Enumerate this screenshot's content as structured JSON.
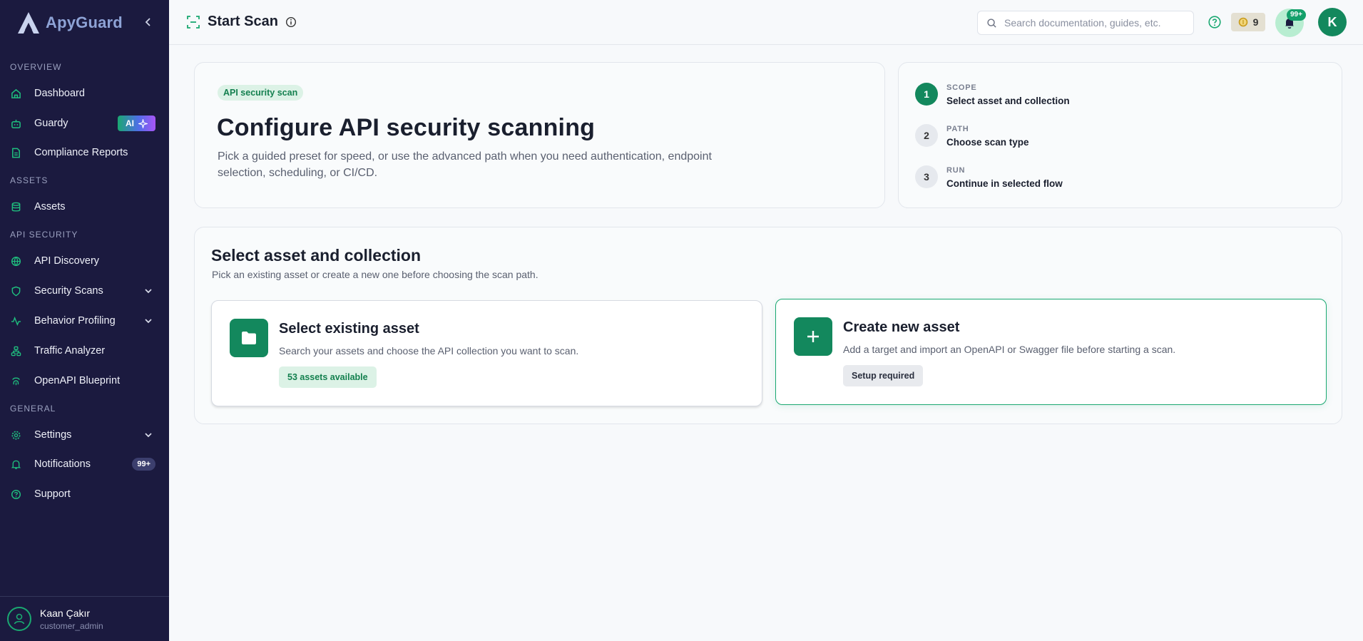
{
  "brand": {
    "name": "ApyGuard"
  },
  "sidebar": {
    "sections": {
      "overview": "OVERVIEW",
      "assets": "ASSETS",
      "api_security": "API SECURITY",
      "general": "GENERAL"
    },
    "items": {
      "dashboard": "Dashboard",
      "guardy": "Guardy",
      "guardy_badge": "AI",
      "compliance": "Compliance Reports",
      "assets": "Assets",
      "api_discovery": "API Discovery",
      "security_scans": "Security Scans",
      "behavior_profiling": "Behavior Profiling",
      "traffic_analyzer": "Traffic Analyzer",
      "openapi_blueprint": "OpenAPI Blueprint",
      "settings": "Settings",
      "notifications": "Notifications",
      "notifications_count": "99+",
      "support": "Support"
    },
    "user": {
      "name": "Kaan Çakır",
      "role": "customer_admin"
    }
  },
  "topbar": {
    "title": "Start Scan",
    "search_placeholder": "Search documentation, guides, etc.",
    "credits": "9",
    "notifications_badge": "99+",
    "avatar_initial": "K"
  },
  "hero": {
    "pill": "API security scan",
    "title": "Configure API security scanning",
    "description": "Pick a guided preset for speed, or use the advanced path when you need authentication, endpoint selection, scheduling, or CI/CD."
  },
  "steps": [
    {
      "number": "1",
      "kicker": "SCOPE",
      "title": "Select asset and collection",
      "state": "active"
    },
    {
      "number": "2",
      "kicker": "PATH",
      "title": "Choose scan type",
      "state": "idle"
    },
    {
      "number": "3",
      "kicker": "RUN",
      "title": "Continue in selected flow",
      "state": "idle"
    }
  ],
  "scope": {
    "title": "Select asset and collection",
    "description": "Pick an existing asset or create a new one before choosing the scan path.",
    "existing": {
      "title": "Select existing asset",
      "description": "Search your assets and choose the API collection you want to scan.",
      "chip": "53 assets available"
    },
    "create": {
      "title": "Create new asset",
      "description": "Add a target and import an OpenAPI or Swagger file before starting a scan.",
      "chip": "Setup required"
    }
  },
  "colors": {
    "sidebar_bg": "#1b1a3f",
    "accent": "#13885d",
    "accent_light": "#1aa871"
  }
}
